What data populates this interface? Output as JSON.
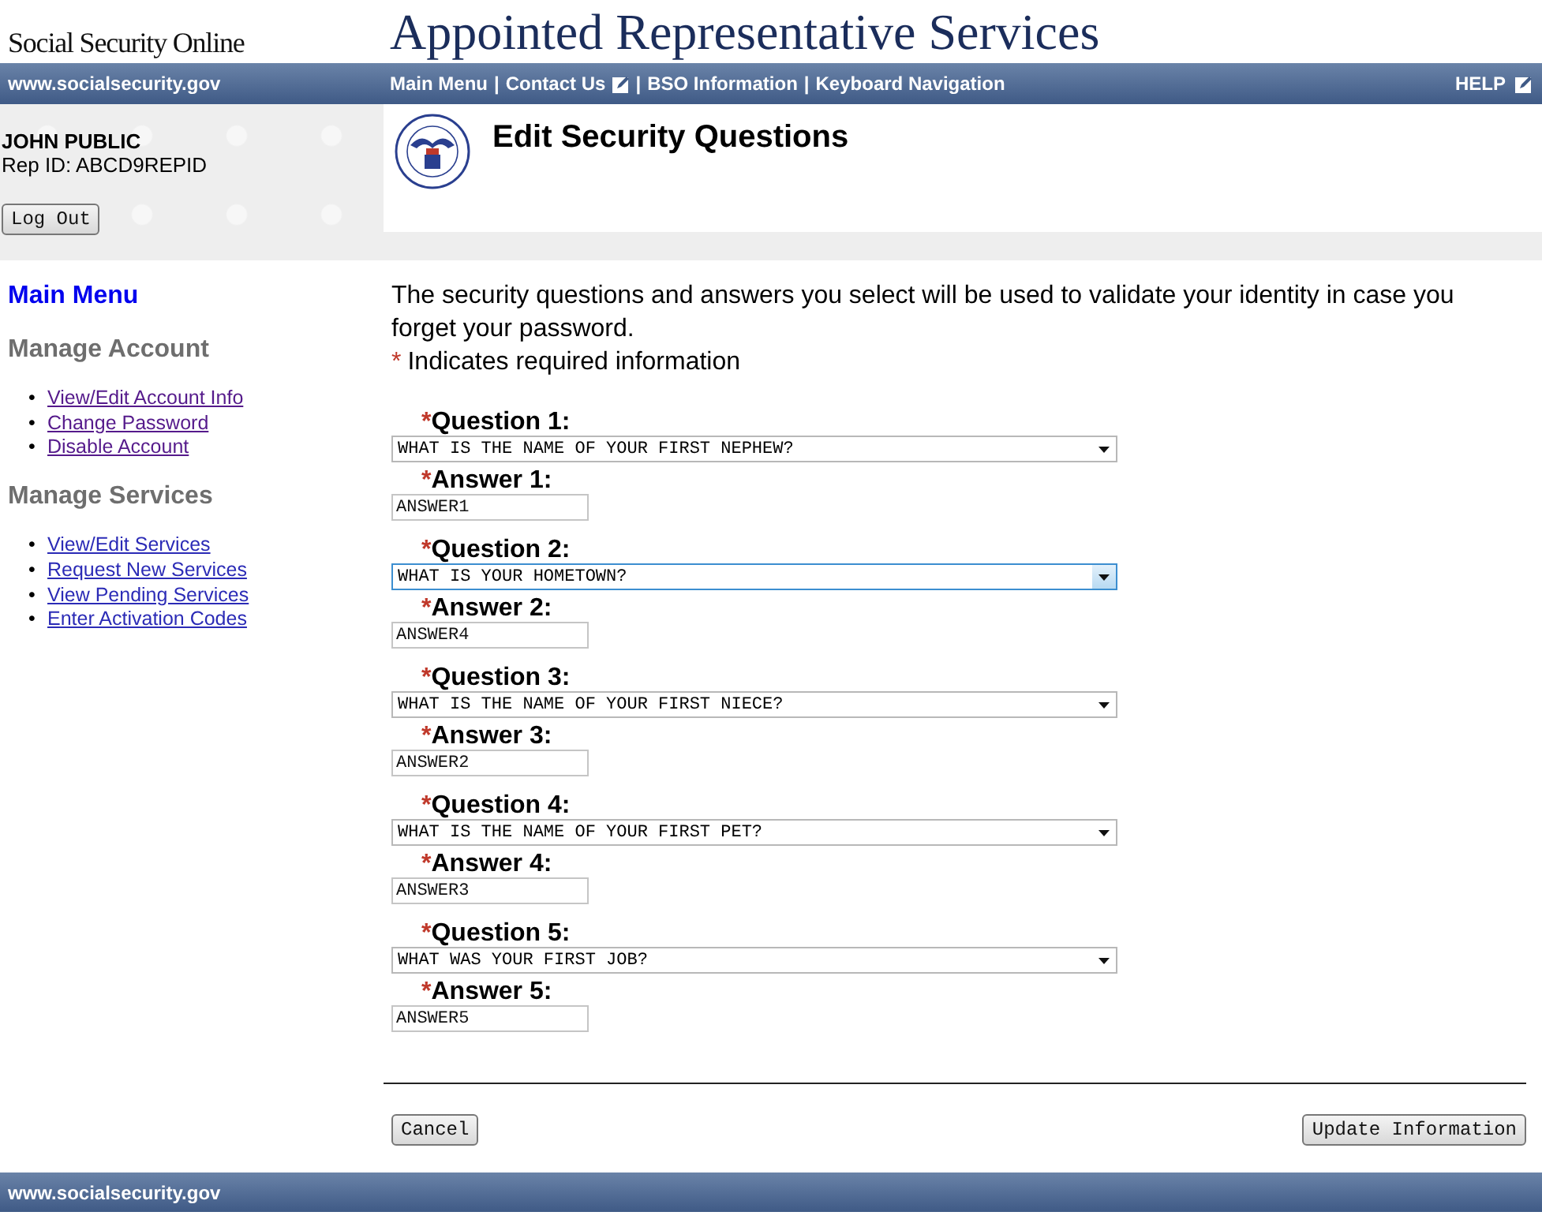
{
  "site": {
    "name": "Social Security Online",
    "title": "Appointed Representative Services"
  },
  "nav": {
    "site_link": "www.socialsecurity.gov",
    "items": [
      {
        "kind": "link",
        "label": "Main Menu"
      },
      {
        "kind": "separator",
        "label": "|"
      },
      {
        "kind": "link",
        "label": "Contact Us"
      },
      {
        "kind": "icon"
      },
      {
        "kind": "separator",
        "label": "|"
      },
      {
        "kind": "link",
        "label": "BSO Information"
      },
      {
        "kind": "separator",
        "label": "|"
      },
      {
        "kind": "link",
        "label": "Keyboard Navigation"
      }
    ],
    "help": "HELP"
  },
  "user": {
    "name": "JOHN PUBLIC",
    "rep_id": "Rep ID: ABCD9REPID",
    "logout": "Log Out"
  },
  "page_title": "Edit Security Questions",
  "sidebar": {
    "main_menu": "Main Menu",
    "sections": [
      {
        "heading": "Manage Account",
        "links": [
          {
            "bullet": "•",
            "label": "View/Edit Account Info"
          },
          {
            "bullet": "•",
            "label": "Change Password"
          },
          {
            "bullet": "•",
            "label": "Disable Account"
          }
        ]
      },
      {
        "heading": "Manage Services",
        "links": [
          {
            "bullet": "•",
            "label": "View/Edit Services"
          },
          {
            "bullet": "•",
            "label": "Request New Services"
          },
          {
            "bullet": "•",
            "label": "View Pending Services"
          },
          {
            "bullet": "•",
            "label": "Enter Activation Codes"
          }
        ]
      }
    ]
  },
  "intro": "The security questions and answers you select will be used to validate your identity in case you forget your password.",
  "required_note": {
    "mark": "*",
    "text": "Indicates required information"
  },
  "questions": [
    {
      "question_mark": "*",
      "label": "Question 1:",
      "value": "WHAT IS THE NAME OF YOUR FIRST NEPHEW?",
      "focused": false,
      "answer_mark": "*",
      "answer_label": "Answer 1:",
      "answer": "ANSWER1"
    },
    {
      "question_mark": "*",
      "label": "Question 2:",
      "value": "WHAT IS YOUR HOMETOWN?",
      "focused": true,
      "answer_mark": "*",
      "answer_label": "Answer 2:",
      "answer": "ANSWER4"
    },
    {
      "question_mark": "*",
      "label": "Question 3:",
      "value": "WHAT IS THE NAME OF YOUR FIRST NIECE?",
      "focused": false,
      "answer_mark": "*",
      "answer_label": "Answer 3:",
      "answer": "ANSWER2"
    },
    {
      "question_mark": "*",
      "label": "Question 4:",
      "value": "WHAT IS THE NAME OF YOUR FIRST PET?",
      "focused": false,
      "answer_mark": "*",
      "answer_label": "Answer 4:",
      "answer": "ANSWER3"
    },
    {
      "question_mark": "*",
      "label": "Question 5:",
      "value": "WHAT WAS YOUR FIRST JOB?",
      "focused": false,
      "answer_mark": "*",
      "answer_label": "Answer 5:",
      "answer": "ANSWER5"
    }
  ],
  "buttons": {
    "cancel": "Cancel",
    "update": "Update Information"
  },
  "footer": "www.socialsecurity.gov"
}
